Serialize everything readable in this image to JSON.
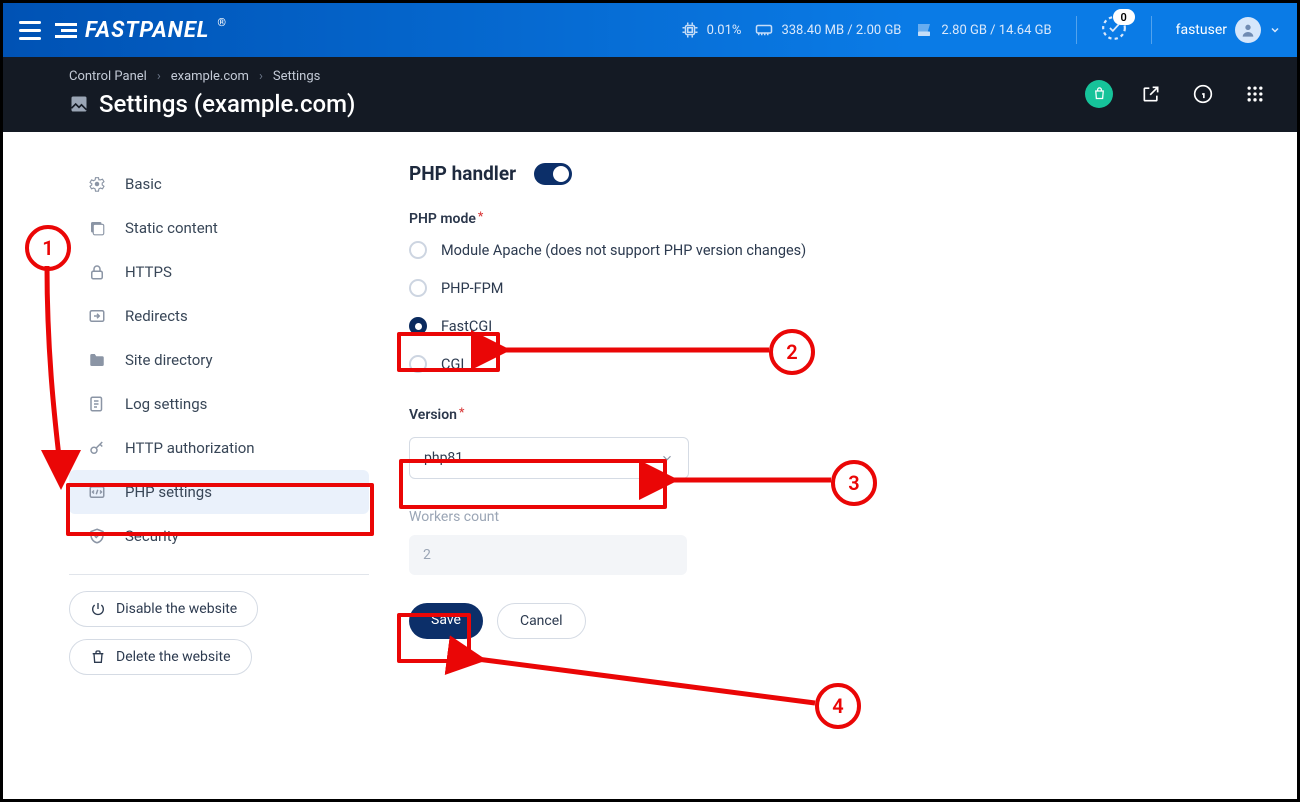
{
  "top": {
    "logo_text": "FASTPANEL",
    "cpu": "0.01%",
    "mem": "338.40 MB / 2.00 GB",
    "disk": "2.80 GB / 14.64 GB",
    "notif_count": "0",
    "username": "fastuser"
  },
  "breadcrumbs": [
    "Control Panel",
    "example.com",
    "Settings"
  ],
  "page_title": "Settings (example.com)",
  "sidebar": {
    "items": [
      {
        "icon": "gear",
        "label": "Basic"
      },
      {
        "icon": "static",
        "label": "Static content"
      },
      {
        "icon": "lock",
        "label": "HTTPS"
      },
      {
        "icon": "redirect",
        "label": "Redirects"
      },
      {
        "icon": "folder",
        "label": "Site directory"
      },
      {
        "icon": "log",
        "label": "Log settings"
      },
      {
        "icon": "key",
        "label": "HTTP authorization"
      },
      {
        "icon": "php",
        "label": "PHP settings"
      },
      {
        "icon": "shield",
        "label": "Security"
      }
    ],
    "disable_btn": "Disable the website",
    "delete_btn": "Delete the website"
  },
  "form": {
    "section": "PHP handler",
    "mode_label": "PHP mode",
    "modes": [
      "Module Apache (does not support PHP version changes)",
      "PHP-FPM",
      "FastCGI",
      "CGI"
    ],
    "selected_mode_index": 2,
    "version_label": "Version",
    "version_value": "php81",
    "workers_label": "Workers count",
    "workers_value": "2",
    "save": "Save",
    "cancel": "Cancel"
  },
  "annotations": {
    "a1": "1",
    "a2": "2",
    "a3": "3",
    "a4": "4"
  }
}
